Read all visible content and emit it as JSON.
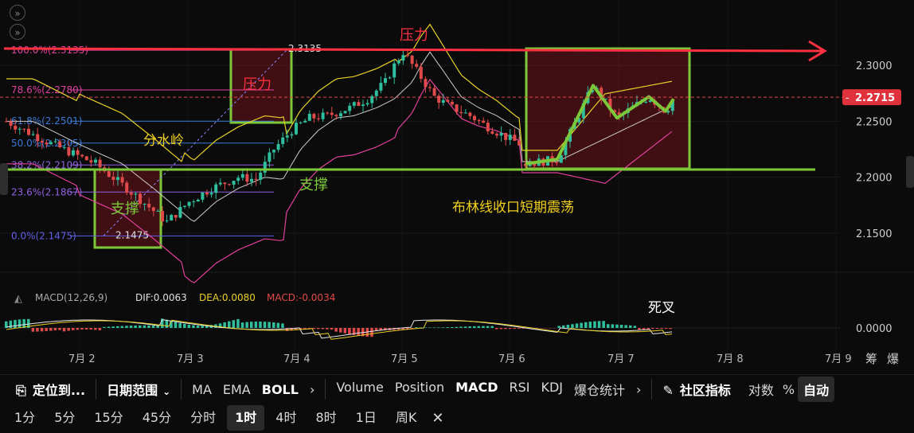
{
  "chart_data": {
    "type": "candlestick",
    "price_axis": {
      "min": 2.12,
      "max": 2.33,
      "ticks": [
        "2.3000",
        "2.2500",
        "2.2000",
        "2.1500"
      ]
    },
    "last_price": "2.2715",
    "x_ticks": [
      "7月 2",
      "7月 3",
      "7月 4",
      "7月 5",
      "7月 6",
      "7月 7",
      "7月 8",
      "7月 9"
    ],
    "fib_levels": [
      {
        "label": "100.0%(2.3135)",
        "value": 2.3135,
        "color": "#e040a0"
      },
      {
        "label": "78.6%(2.2780)",
        "value": 2.278,
        "color": "#e040a0"
      },
      {
        "label": "61.8%(2.2501)",
        "value": 2.2501,
        "color": "#3a7ad8"
      },
      {
        "label": "50.0%(2.2305)",
        "value": 2.2305,
        "color": "#3a7ad8"
      },
      {
        "label": "38.2%(2.2109)",
        "value": 2.2109,
        "color": "#9060e0"
      },
      {
        "label": "23.6%(2.1867)",
        "value": 2.1867,
        "color": "#9060e0"
      },
      {
        "label": "0.0%(2.1475)",
        "value": 2.1475,
        "color": "#6060e8"
      }
    ],
    "high_label": "2.3135",
    "low_label": "2.1475",
    "annotations": {
      "resistance": "压力",
      "resistance_box": "压力",
      "support": "支撑",
      "support_box": "支撑",
      "watershed": "分水岭",
      "bollinger_note": "布林线收口短期震荡",
      "death_cross": "死叉"
    },
    "macd": {
      "label": "MACD(12,26,9)",
      "dif": "DIF:0.0063",
      "dea": "DEA:0.0080",
      "macd": "MACD:-0.0034",
      "axis_label": "0.0000"
    },
    "corner_labels": [
      "筹",
      "爆"
    ]
  },
  "toolbar": {
    "locate": "定位到...",
    "date_range": "日期范围",
    "indicators_main": [
      {
        "label": "MA",
        "active": false
      },
      {
        "label": "EMA",
        "active": false
      },
      {
        "label": "BOLL",
        "active": true
      }
    ],
    "indicators_sub": [
      {
        "label": "Volume",
        "active": false
      },
      {
        "label": "Position",
        "active": false
      },
      {
        "label": "MACD",
        "active": true
      },
      {
        "label": "RSI",
        "active": false
      },
      {
        "label": "KDJ",
        "active": false
      },
      {
        "label": "爆仓统计",
        "active": false
      }
    ],
    "community": "社区指标",
    "log_scale": "对数",
    "percent": "%",
    "auto": "自动"
  },
  "intervals": {
    "items": [
      "1分",
      "5分",
      "15分",
      "45分",
      "分时",
      "1时",
      "4时",
      "8时",
      "1日",
      "周K"
    ],
    "active": "1时"
  },
  "colors": {
    "up": "#2fbf9e",
    "down": "#e04a4a",
    "green_annotation": "#7dc83a",
    "red_annotation": "#ff3040",
    "yellow_text": "#f0d020",
    "boll_upper": "#e8d028",
    "boll_mid": "#cccccc",
    "boll_lower": "#e0409a"
  }
}
